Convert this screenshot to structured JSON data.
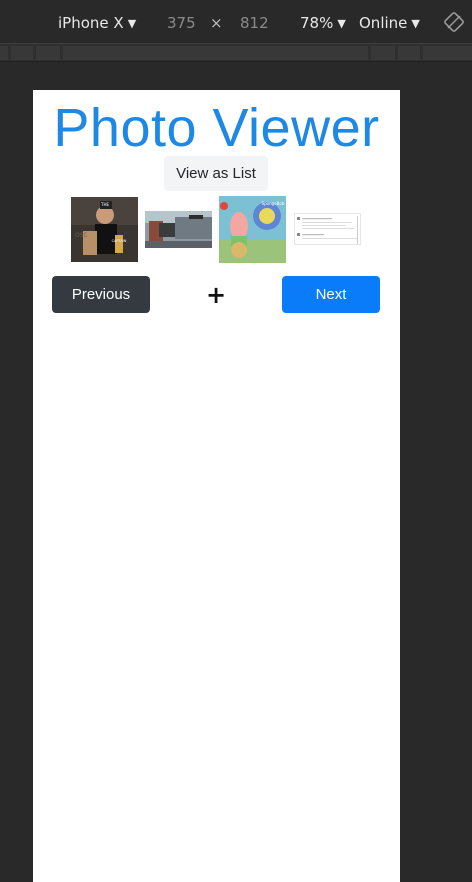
{
  "devtools": {
    "device": "iPhone X",
    "width": "375",
    "separator": "×",
    "height": "812",
    "zoom": "78%",
    "network": "Online"
  },
  "app": {
    "title": "Photo Viewer",
    "view_toggle_label": "View as List",
    "previous_label": "Previous",
    "next_label": "Next",
    "add_symbol": "+",
    "thumb1_text_top": "THE",
    "thumb1_text_bottom": "CAPTAIN",
    "thumb3_text": "SpongeBob"
  },
  "colors": {
    "title": "#1e88e5",
    "next_button": "#0a7cf9",
    "previous_button": "#343a40"
  }
}
